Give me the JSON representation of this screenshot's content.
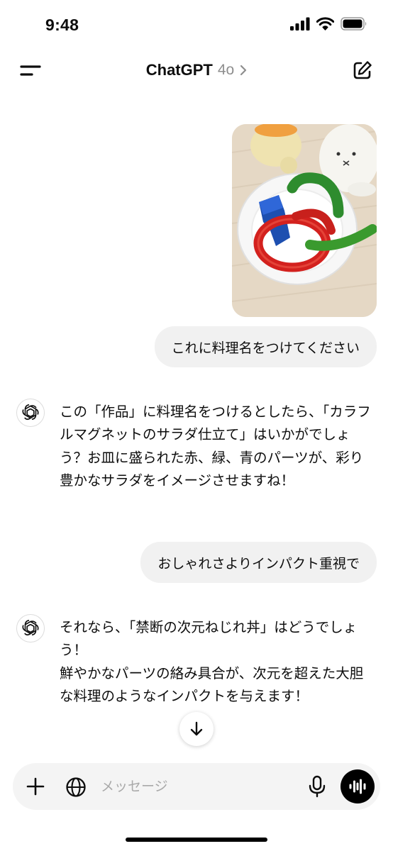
{
  "status_bar": {
    "time": "9:48",
    "icons": [
      "cellular-signal-icon",
      "wifi-icon",
      "battery-icon"
    ]
  },
  "header": {
    "title": "ChatGPT",
    "model": "4o",
    "menu_icon": "sidebar-menu-icon",
    "chevron_icon": "chevron-right-icon",
    "new_chat_icon": "compose-icon"
  },
  "conversation": {
    "user_image_icon": "photo-attachment",
    "user_message_1": "これに料理名をつけてください",
    "assistant_message_1": "この「作品」に料理名をつけるとしたら、「カラフルマグネットのサラダ仕立て」はいかがでしょう？お皿に盛られた赤、緑、青のパーツが、彩り豊かなサラダをイメージさせますね！",
    "user_message_2": "おしゃれさよりインパクト重視で",
    "assistant_message_2_line1": "それなら、「禁断の次元ねじれ丼」はどうでしょう！",
    "assistant_message_2_line2": "鮮やかなパーツの絡み具合が、次元を超えた大胆な料理のようなインパクトを与えます！",
    "assistant_avatar_icon": "openai-logo-icon"
  },
  "scroll_button_icon": "arrow-down-icon",
  "composer": {
    "placeholder": "メッセージ",
    "value": "",
    "icons": [
      "plus-icon",
      "globe-icon",
      "microphone-icon",
      "voice-mode-icon"
    ]
  },
  "colors": {
    "bubble_bg": "#f1f1f1",
    "composer_bg": "#f4f4f4",
    "placeholder": "#a9a9a9",
    "model_label": "#8e8e8e"
  }
}
